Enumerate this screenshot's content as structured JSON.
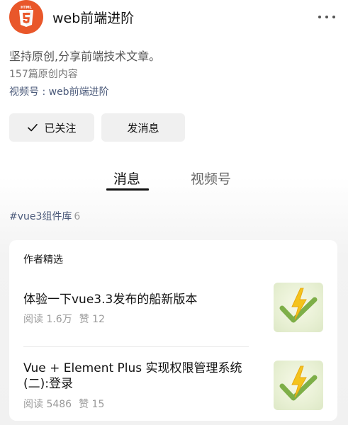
{
  "header": {
    "account_name": "web前端进阶",
    "more_icon": "more-dots-icon"
  },
  "profile": {
    "description": "坚持原创,分享前端技术文章。",
    "post_count": "157篇原创内容",
    "channel": "视频号 : web前端进阶"
  },
  "actions": {
    "follow_label": "已关注",
    "message_label": "发消息"
  },
  "tabs": [
    {
      "label": "消息",
      "active": true
    },
    {
      "label": "视频号",
      "active": false
    }
  ],
  "hashtag": {
    "label": "#vue3组件库",
    "count": "6"
  },
  "featured": {
    "title": "作者精选",
    "articles": [
      {
        "title": "体验一下vue3.3发布的船新版本",
        "reads": "阅读 1.6万",
        "likes": "赞 12"
      },
      {
        "title": "Vue + Element Plus 实现权限管理系统(二):登录",
        "reads": "阅读 5486",
        "likes": "赞 15"
      }
    ]
  },
  "colors": {
    "avatar_bg": "#e9572a",
    "link": "#4b5a7a",
    "thumb_bolt": "#f4c31d",
    "thumb_check": "#6aa22e"
  }
}
